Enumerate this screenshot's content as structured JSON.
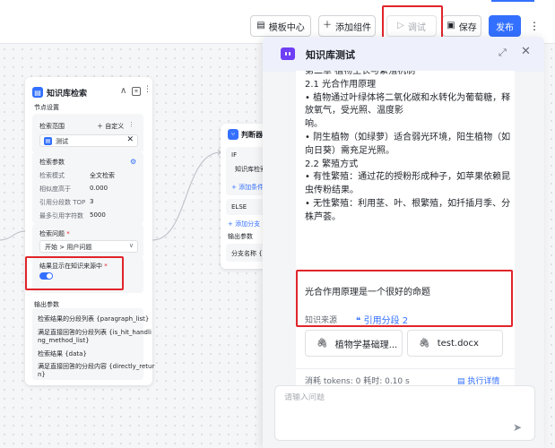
{
  "toolbar": {
    "template_label": "模板中心",
    "add_label": "添加组件",
    "debug_label": "调试",
    "save_label": "保存",
    "publish_label": "发布"
  },
  "node": {
    "title": "知识库检索",
    "section_settings": "节点设置",
    "search_scope": "检索范围",
    "custom": "自定义",
    "kb_name": "测试",
    "params_title": "检索参数",
    "param_mode_label": "检索模式",
    "param_mode_value": "全文检索",
    "param_sim_label": "相似度高于",
    "param_sim_value": "0.000",
    "param_topk_label": "引用分段数 TOP",
    "param_topk_value": "3",
    "param_max_label": "最多引用字符数",
    "param_max_value": "5000",
    "question_label": "检索问题",
    "question_value": "开始 > 用户问题",
    "show_source_label": "结果显示在知识来源中",
    "output_title": "输出参数",
    "output_items": [
      "检索结果的分段列表 {paragraph_list}",
      "满足直接回答的分段列表 {is_hit_handli",
      "ng_method_list}",
      "检索结果 {data}",
      "满足直接回答的分段内容 {directly_retur",
      "n}"
    ]
  },
  "judge": {
    "title": "判断器",
    "if_label": "IF",
    "if_value": "知识库检索",
    "add_condition": "+ 添加条件",
    "else_label": "ELSE",
    "add_branch": "+ 添加分支",
    "output_title": "输出参数",
    "branch_name": "分支名称 {bra"
  },
  "chat": {
    "title": "知识库测试",
    "lines": [
      "第二章 植物生长与繁殖机制",
      "2.1 光合作用原理",
      "• 植物通过叶绿体将二氧化碳和水转化为葡萄糖，释",
      "放氧气，受光照、温度影",
      "响。",
      "• 阴生植物（如绿萝）适合弱光环境，阳生植物（如",
      "向日葵）需充足光照。",
      "2.2 繁殖方式",
      "• 有性繁殖：通过花的授粉形成种子，如苹果依赖昆",
      "虫传粉结果。",
      "• 无性繁殖：利用茎、叶、根繁殖，如扦插月季、分",
      "株芦荟。"
    ],
    "last_line": "光合作用原理是一个很好的命题",
    "source_label": "知识来源",
    "source_link": "引用分段 2",
    "files": [
      "植物学基础理...",
      "test.docx"
    ],
    "stats": "消耗 tokens: 0   耗时: 0.10 s",
    "detail_label": "执行详情",
    "input_placeholder": "请输入问题"
  },
  "colors": {
    "accent": "#3370ff",
    "highlight": "#e0252b",
    "bot": "#6f3ff5"
  }
}
